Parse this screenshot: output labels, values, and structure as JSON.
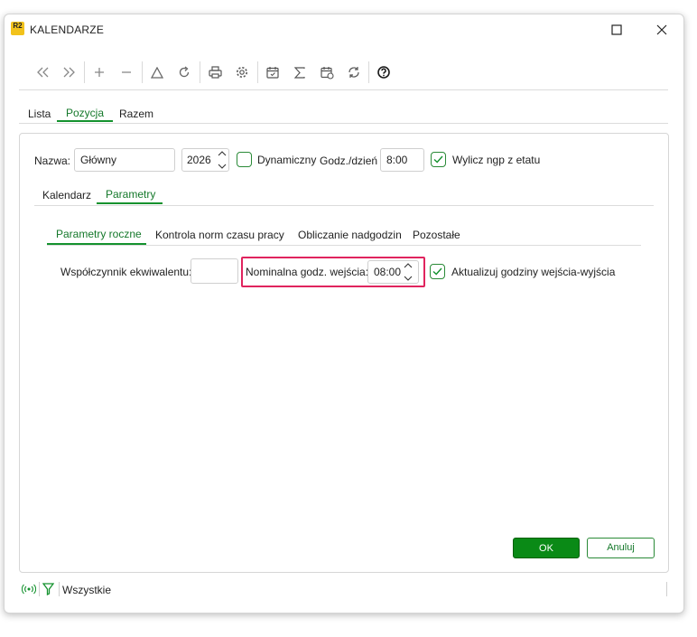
{
  "window": {
    "logo_text": "R2",
    "title": "KALENDARZE",
    "maximize_icon": "maximize-icon",
    "close_icon": "close-icon"
  },
  "toolbar": {
    "buttons": [
      {
        "name": "first-record-icon",
        "glyph": "«"
      },
      {
        "name": "last-record-icon",
        "glyph": "»"
      },
      {
        "name": "add-icon",
        "glyph": "+"
      },
      {
        "name": "remove-icon",
        "glyph": "−"
      },
      {
        "name": "triangle-icon",
        "glyph": "△"
      },
      {
        "name": "refresh-icon",
        "glyph": "↻"
      },
      {
        "name": "print-icon",
        "glyph": "🖶"
      },
      {
        "name": "settings-icon",
        "glyph": "⚙"
      },
      {
        "name": "calendar-check-icon",
        "glyph": "📅"
      },
      {
        "name": "sigma-icon",
        "glyph": "Σ"
      },
      {
        "name": "calendar-clock-icon",
        "glyph": "📅"
      },
      {
        "name": "sync-icon",
        "glyph": "⟳"
      },
      {
        "name": "help-icon",
        "glyph": "?"
      }
    ]
  },
  "top_tabs": [
    "Lista",
    "Pozycja",
    "Razem"
  ],
  "form": {
    "name_label": "Nazwa:",
    "name_value": "Główny",
    "year_value": "2026",
    "dynamic_label": "Dynamiczny",
    "hours_label": "Godz./dzień",
    "hours_value": "8:00",
    "calc_ngp_label": "Wylicz ngp z etatu",
    "calc_ngp_checked": true,
    "dynamic_checked": false
  },
  "sub_tabs": [
    "Kalendarz",
    "Parametry"
  ],
  "param_tabs": [
    "Parametry roczne",
    "Kontrola norm czasu pracy",
    "Obliczanie nadgodzin",
    "Pozostałe"
  ],
  "params": {
    "coef_label": "Współczynnik ekwiwalentu:",
    "coef_value": "",
    "nominal_label": "Nominalna godz. wejścia:",
    "nominal_value": "08:00",
    "update_label": "Aktualizuj godziny wejścia-wyjścia",
    "update_checked": true
  },
  "buttons": {
    "ok": "OK",
    "cancel": "Anuluj"
  },
  "status_bar": {
    "filter_label": "Wszystkie"
  },
  "colors": {
    "accent_green": "#14922e",
    "highlight_pink": "#e0245e"
  }
}
